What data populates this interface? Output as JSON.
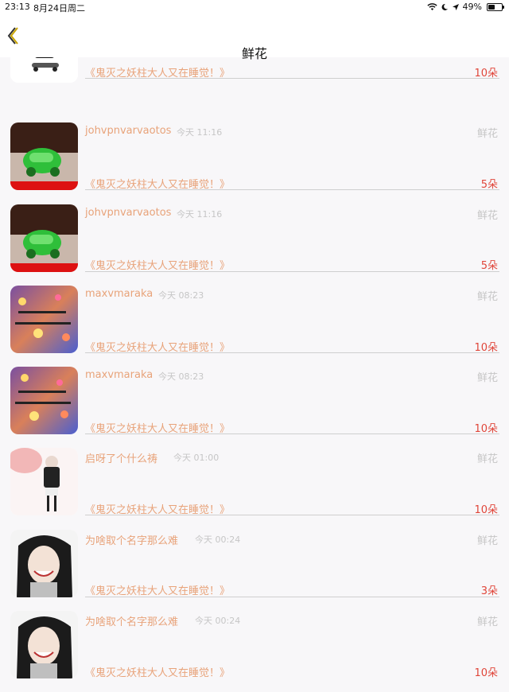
{
  "status": {
    "time": "23:13",
    "date": "8月24日周二",
    "battery": "49%",
    "battery_level": 0.49
  },
  "nav": {
    "title": "鲜花"
  },
  "gift_label": "鲜花",
  "items": [
    {
      "book": "《鬼灭之妖柱大人又在睡觉！》",
      "count": "10朵"
    },
    {
      "name": "johvpnvarvaotos",
      "time": "今天 11:16",
      "book": "《鬼灭之妖柱大人又在睡觉！》",
      "count": "5朵"
    },
    {
      "name": "johvpnvarvaotos",
      "time": "今天 11:16",
      "book": "《鬼灭之妖柱大人又在睡觉！》",
      "count": "5朵"
    },
    {
      "name": "maxvmaraka",
      "time": "今天 08:23",
      "book": "《鬼灭之妖柱大人又在睡觉！》",
      "count": "10朵"
    },
    {
      "name": "maxvmaraka",
      "time": "今天 08:23",
      "book": "《鬼灭之妖柱大人又在睡觉！》",
      "count": "10朵"
    },
    {
      "name": "启呀了个什么祷",
      "time": "今天 01:00",
      "book": "《鬼灭之妖柱大人又在睡觉！》",
      "count": "10朵"
    },
    {
      "name": "为啥取个名字那么难",
      "time": "今天 00:24",
      "book": "《鬼灭之妖柱大人又在睡觉！》",
      "count": "3朵"
    },
    {
      "name": "为啥取个名字那么难",
      "time": "今天 00:24",
      "book": "《鬼灭之妖柱大人又在睡觉！》",
      "count": "10朵"
    }
  ]
}
